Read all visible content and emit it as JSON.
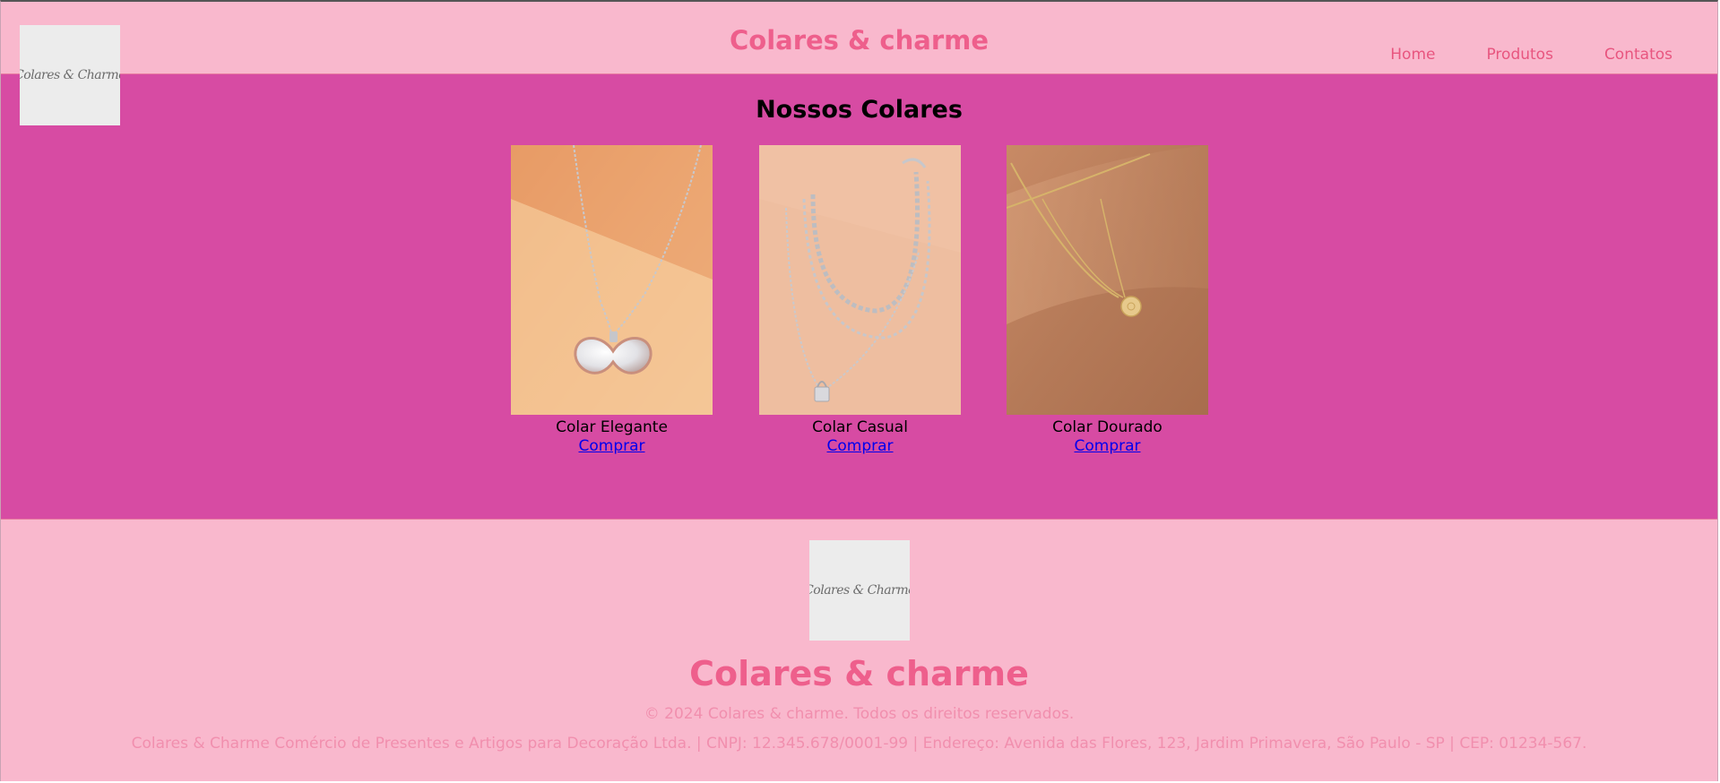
{
  "header": {
    "logo_text": "Colares & Charme",
    "title": "Colares & charme",
    "nav": [
      {
        "label": "Home"
      },
      {
        "label": "Produtos"
      },
      {
        "label": "Contatos"
      }
    ]
  },
  "main": {
    "heading": "Nossos Colares",
    "products": [
      {
        "name": "Colar Elegante",
        "link": "Comprar",
        "image": "heart-locket-necklace-photo"
      },
      {
        "name": "Colar Casual",
        "link": "Comprar",
        "image": "layered-chain-padlock-necklace-photo"
      },
      {
        "name": "Colar Dourado",
        "link": "Comprar",
        "image": "gold-coin-pendant-necklace-photo"
      }
    ]
  },
  "footer": {
    "logo_text": "Colares & Charme",
    "title": "Colares & charme",
    "copyright": "© 2024 Colares & charme. Todos os direitos reservados.",
    "legal": "Colares & Charme Comércio de Presentes e Artigos para Decoração Ltda. | CNPJ: 12.345.678/0001-99 | Endereço: Avenida das Flores, 123, Jardim Primavera, São Paulo - SP | CEP: 01234-567."
  },
  "colors": {
    "header_bg": "#f9b8cd",
    "main_bg": "#d74ba3",
    "title_pink": "#ee5f8c",
    "link_blue": "#0000ee"
  }
}
